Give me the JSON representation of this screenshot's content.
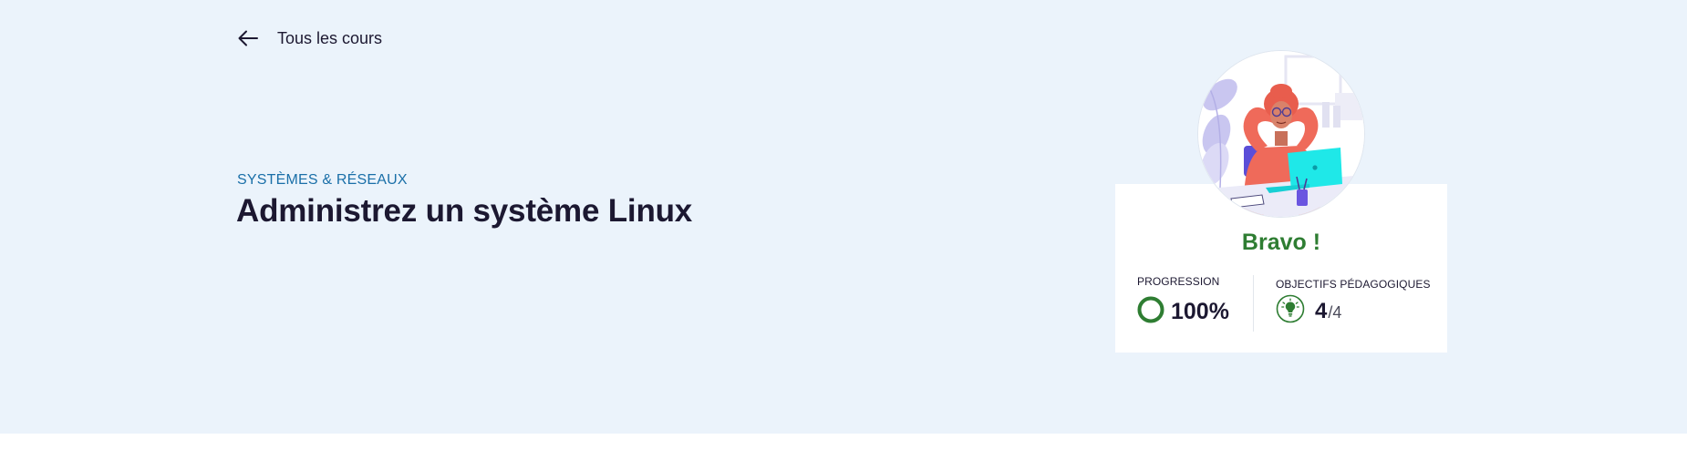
{
  "nav": {
    "back_label": "Tous les cours",
    "back_icon": "arrow-left-icon"
  },
  "course": {
    "category": "SYSTÈMES & RÉSEAUX",
    "title": "Administrez un système Linux"
  },
  "completion_card": {
    "message": "Bravo !",
    "progress": {
      "label": "PROGRESSION",
      "value": "100%",
      "fraction": 1.0,
      "icon": "progress-ring-icon"
    },
    "objectives": {
      "label": "OBJECTIFS PÉDAGOGIQUES",
      "completed": "4",
      "total_text": "/4",
      "icon": "lightbulb-icon"
    }
  },
  "colors": {
    "hero_background": "#ebf3fb",
    "accent_green": "#2e7d32",
    "category_blue": "#1a6fa8",
    "text_dark": "#1c1831"
  }
}
